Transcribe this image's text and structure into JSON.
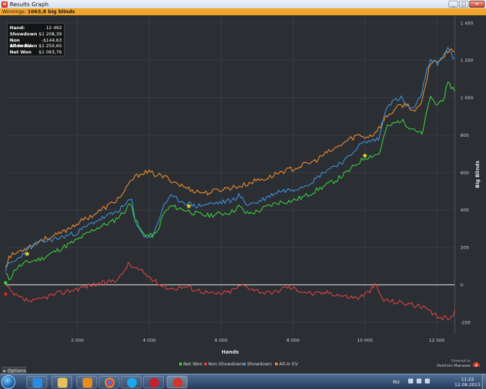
{
  "window": {
    "title": "Results Graph",
    "app_icon": "holdem-manager-icon",
    "min": "_",
    "max": "□",
    "close": "✕"
  },
  "winnings_bar": {
    "label": "Winnings:",
    "value": "1063,8 big blinds"
  },
  "stats": [
    {
      "label": "Hand:",
      "value": "12 492"
    },
    {
      "label": "Showdown",
      "value": "$1 208,39"
    },
    {
      "label": "Non Showdown",
      "value": "-$144,63"
    },
    {
      "label": "All-In EV",
      "value": "$1 250,65"
    },
    {
      "label": "Net Won",
      "value": "$1 063,76"
    }
  ],
  "options_label": "Options",
  "branding": {
    "line1": "Powered by",
    "line2": "Hold'em Manager",
    "badge": "2"
  },
  "taskbar": {
    "lang": "RU",
    "time": "11:22",
    "date": "12.09.2013"
  },
  "chart_data": {
    "type": "line",
    "xlabel": "Hands",
    "ylabel": "Big Blinds",
    "xlim": [
      0,
      12500
    ],
    "ylim": [
      -260,
      1440
    ],
    "x_ticks": [
      2000,
      4000,
      6000,
      8000,
      10000,
      12000
    ],
    "x_tick_labels": [
      "2 000",
      "4 000",
      "6 000",
      "8 000",
      "10 000",
      "12 000"
    ],
    "y_ticks": [
      -200,
      0,
      200,
      400,
      600,
      800,
      1000,
      1200,
      1400
    ],
    "y_tick_labels": [
      "-200",
      "0",
      "200",
      "400",
      "600",
      "800",
      "1 000",
      "1 200",
      "1 400"
    ],
    "grid": true,
    "legend_position": "bottom-center",
    "series": [
      {
        "name": "Net Won",
        "color": "#3ec93e",
        "x": [
          0,
          100,
          300,
          600,
          1000,
          1500,
          2000,
          2500,
          3000,
          3300,
          3500,
          3600,
          3800,
          4000,
          4200,
          4400,
          4600,
          5000,
          5300,
          5600,
          6000,
          6300,
          6500,
          6700,
          7000,
          7300,
          7600,
          8000,
          8300,
          8600,
          8900,
          9200,
          9500,
          9800,
          10000,
          10200,
          10400,
          10600,
          11000,
          11200,
          11400,
          11600,
          11800,
          12000,
          12200,
          12300,
          12400,
          12500
        ],
        "y": [
          60,
          30,
          90,
          120,
          140,
          190,
          240,
          300,
          340,
          390,
          440,
          350,
          280,
          260,
          270,
          380,
          420,
          400,
          380,
          370,
          380,
          390,
          420,
          380,
          390,
          420,
          440,
          450,
          470,
          500,
          530,
          560,
          600,
          650,
          680,
          690,
          700,
          840,
          880,
          850,
          830,
          800,
          1000,
          960,
          1000,
          1070,
          1060,
          1040
        ]
      },
      {
        "name": "Showdown",
        "color": "#3f8fd4",
        "x": [
          0,
          100,
          300,
          600,
          1000,
          1500,
          2000,
          2500,
          3000,
          3300,
          3500,
          3600,
          3800,
          4000,
          4200,
          4400,
          4600,
          5000,
          5300,
          5600,
          6000,
          6300,
          6500,
          6700,
          7000,
          7300,
          7600,
          8000,
          8300,
          8600,
          8900,
          9200,
          9500,
          9800,
          10000,
          10200,
          10400,
          10600,
          11000,
          11200,
          11400,
          11600,
          11800,
          12000,
          12200,
          12300,
          12400,
          12500
        ],
        "y": [
          80,
          110,
          130,
          190,
          230,
          250,
          280,
          340,
          380,
          420,
          460,
          350,
          270,
          250,
          300,
          430,
          470,
          440,
          420,
          430,
          440,
          450,
          480,
          430,
          440,
          470,
          500,
          510,
          530,
          560,
          610,
          640,
          670,
          740,
          760,
          770,
          780,
          960,
          1000,
          950,
          940,
          1040,
          1200,
          1180,
          1230,
          1270,
          1230,
          1200
        ]
      },
      {
        "name": "Non Showdown",
        "color": "#d84343",
        "x": [
          0,
          200,
          500,
          800,
          1200,
          1600,
          2000,
          2400,
          2800,
          3200,
          3400,
          3600,
          3800,
          4000,
          4300,
          4600,
          5000,
          5400,
          5800,
          6200,
          6600,
          7000,
          7400,
          7800,
          8200,
          8600,
          9000,
          9400,
          9800,
          10100,
          10300,
          10500,
          10800,
          11200,
          11600,
          12000,
          12300,
          12500
        ],
        "y": [
          0,
          -50,
          -80,
          -90,
          -60,
          -40,
          -20,
          0,
          10,
          40,
          110,
          90,
          70,
          40,
          0,
          -20,
          -10,
          -30,
          -50,
          -40,
          0,
          -30,
          -50,
          -10,
          -30,
          -50,
          -40,
          -60,
          -70,
          -40,
          0,
          -80,
          -90,
          -100,
          -120,
          -170,
          -180,
          -150
        ]
      },
      {
        "name": "All-In EV",
        "color": "#e88a2e",
        "x": [
          0,
          100,
          300,
          600,
          1000,
          1500,
          2000,
          2500,
          3000,
          3300,
          3500,
          3800,
          4000,
          4500,
          5000,
          5300,
          5600,
          6000,
          6300,
          6600,
          7000,
          7300,
          7600,
          8000,
          8300,
          8600,
          8900,
          9200,
          9500,
          9800,
          10000,
          10200,
          10400,
          10600,
          11000,
          11200,
          11400,
          11600,
          11800,
          12000,
          12200,
          12300,
          12400,
          12500
        ],
        "y": [
          100,
          150,
          170,
          200,
          240,
          270,
          330,
          380,
          440,
          490,
          560,
          600,
          600,
          570,
          520,
          500,
          490,
          510,
          520,
          530,
          560,
          570,
          600,
          620,
          640,
          660,
          700,
          730,
          770,
          800,
          790,
          800,
          840,
          900,
          960,
          960,
          920,
          980,
          1180,
          1200,
          1220,
          1250,
          1270,
          1240
        ]
      }
    ],
    "markers": [
      {
        "x": 600,
        "y": 165,
        "color": "#f5e020"
      },
      {
        "x": 5100,
        "y": 420,
        "color": "#f5e020"
      },
      {
        "x": 10000,
        "y": 690,
        "color": "#f5e020"
      },
      {
        "x": 0,
        "y": 10,
        "color": "#33dd33"
      },
      {
        "x": 0,
        "y": -50,
        "color": "#e02020"
      }
    ]
  }
}
